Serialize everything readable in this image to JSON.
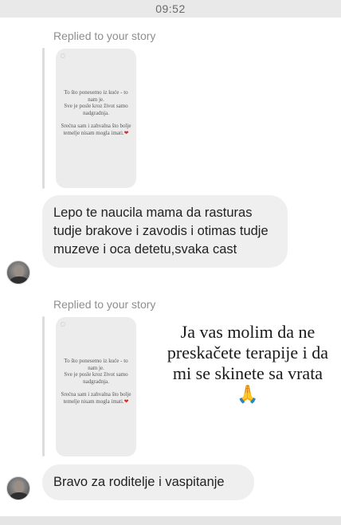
{
  "status_bar": {
    "time": "09:52"
  },
  "thread": [
    {
      "replied_label": "Replied to your story",
      "story": {
        "line1": "To što ponesemo iz kuće - to nam je.",
        "line2": "Sve je posle kroz život samo nadgradnja.",
        "line3": "Srećna sam i zahvalna što bolje temelje nisam mogla imati.",
        "emoji": "❤"
      },
      "message": "Lepo te naucila mama da rasturas tudje brakove i zavodis i otimas tudje muzeve i oca detetu,svaka cast"
    },
    {
      "replied_label": "Replied to your story",
      "story": {
        "line1": "To što ponesemo iz kuće - to nam je.",
        "line2": "Sve je posle kroz život samo nadgradnja.",
        "line3": "Srećna sam i zahvalna što bolje temelje nisam mogla imati.",
        "emoji": "❤"
      },
      "message": "Bravo za roditelje i vaspitanje"
    }
  ],
  "overlay_caption": {
    "line1": "Ja vas molim da ne",
    "line2": "preskačete terapije i da",
    "line3": "mi se skinete sa vrata",
    "emoji": "🙏"
  }
}
